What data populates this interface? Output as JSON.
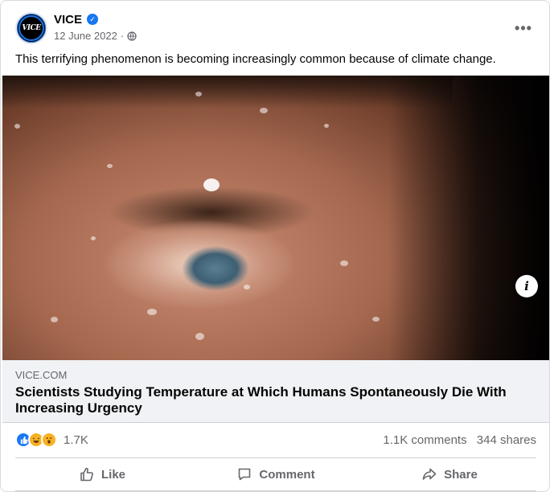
{
  "post": {
    "page_name": "VICE",
    "avatar_text": "VICE",
    "date": "12 June 2022",
    "meta_separator": "·",
    "caption": "This terrifying phenomenon is becoming increasingly common because of climate change.",
    "more_label": "•••",
    "verified_mark": "✓"
  },
  "link": {
    "domain": "VICE.COM",
    "title": "Scientists Studying Temperature at Which Humans Spontaneously Die With Increasing Urgency",
    "info_label": "i"
  },
  "stats": {
    "reaction_count": "1.7K",
    "comments": "1.1K comments",
    "shares": "344 shares",
    "reaction_icons": [
      "like-icon",
      "haha-icon",
      "wow-icon"
    ]
  },
  "actions": {
    "like": "Like",
    "comment": "Comment",
    "share": "Share"
  },
  "colors": {
    "brand_blue": "#1877f2",
    "secondary_text": "#65676b",
    "link_box_bg": "#f0f2f5"
  }
}
